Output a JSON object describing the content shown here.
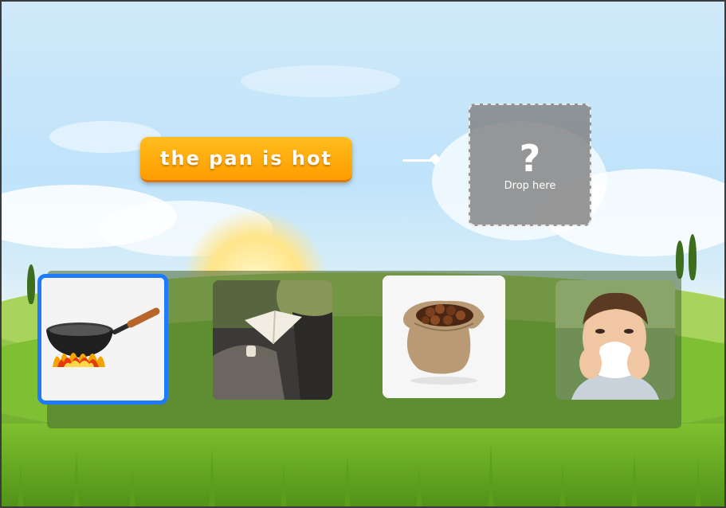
{
  "prompt": {
    "text": "the pan is hot"
  },
  "drop_zone": {
    "symbol": "?",
    "label": "Drop here"
  },
  "choices": [
    {
      "id": "pan",
      "icon": "hot-pan-image",
      "selected": true
    },
    {
      "id": "reading",
      "icon": "person-reading-book-image",
      "selected": false
    },
    {
      "id": "sack",
      "icon": "sack-of-chestnuts-image",
      "selected": false
    },
    {
      "id": "sneeze",
      "icon": "boy-sneezing-tissue-image",
      "selected": false
    }
  ],
  "colors": {
    "prompt_bg": "#ffad0c",
    "selection_border": "#1e7bff",
    "drop_zone_bg": "#8a8a8a"
  }
}
